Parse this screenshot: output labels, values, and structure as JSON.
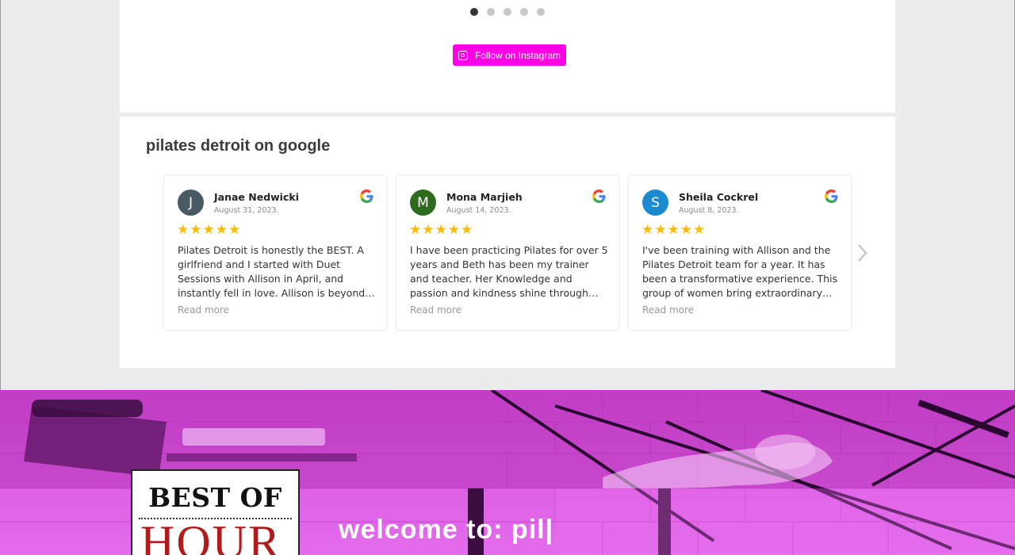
{
  "carousel": {
    "dots": 5,
    "active": 0
  },
  "instagram": {
    "label": "Follow on Instagram",
    "color": "#ff00e6"
  },
  "reviews": {
    "title": "pilates detroit on google",
    "read_more": "Read more",
    "stars": "★★★★★",
    "items": [
      {
        "initial": "J",
        "color": "#4a5a64",
        "name": "Janae Nedwicki",
        "date": "August 31, 2023.",
        "text": "Pilates Detroit is honestly the BEST. A girlfriend and I started with Duet Sessions with Allison in April, and instantly fell in love. Allison is beyond thorough and…"
      },
      {
        "initial": "M",
        "color": "#2f6b1f",
        "name": "Mona Marjieh",
        "date": "August 14, 2023.",
        "text": "I have been practicing Pilates for over 5 years and Beth has been my trainer and teacher. Her Knowledge and passion and kindness shine through her. She's been…"
      },
      {
        "initial": "S",
        "color": "#1a8bd1",
        "name": "Sheila Cockrel",
        "date": "August 8, 2023.",
        "text": "I've been training with Allison and the Pilates Detroit team for a year. It has been a transformative experience. This group of women bring extraordinary skill and…"
      }
    ]
  },
  "hero": {
    "badge_title": "BEST OF",
    "badge_sub": "HOUR",
    "welcome": "welcome to: pil|"
  }
}
